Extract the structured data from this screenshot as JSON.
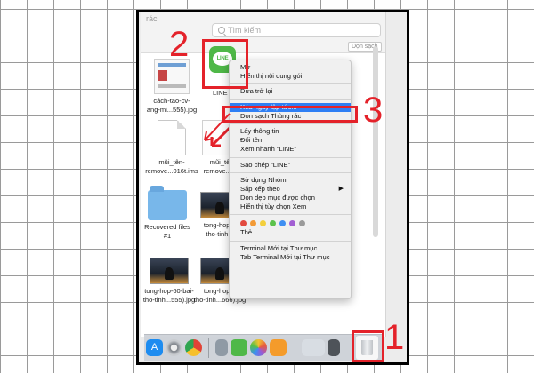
{
  "finder": {
    "title_fragment": "rác",
    "search_placeholder": "Tìm kiếm",
    "clear_button": "Dọn sạch"
  },
  "files": [
    {
      "label": "cách-tao-cv-\nang-mi...555).jpg"
    },
    {
      "label": "LINE"
    },
    {
      "label": "mũi_tên-\nremove...016t.ims"
    },
    {
      "label": "mũi_tê\nremove...w"
    },
    {
      "label": "Recovered files\n#1"
    },
    {
      "label": "tong-hop-6\ntho-tinh..."
    },
    {
      "label": "tong-hop-60-bai-\ntho-tinh...555).jpg"
    },
    {
      "label": "tong-hop-6\ntho-tinh...666).jpg"
    }
  ],
  "context_menu": {
    "group1": [
      "Mở",
      "Hiển thị nội dung gói"
    ],
    "group2": [
      "Đưa trở lại"
    ],
    "selected": "Xóa ngay lập tức...",
    "group3": [
      "Dọn sạch Thùng rác"
    ],
    "group4": [
      "Lấy thông tin",
      "Đổi tên",
      "Xem nhanh “LINE”"
    ],
    "group5": [
      "Sao chép “LINE”"
    ],
    "group6": [
      "Sử dụng Nhóm",
      "Sắp xếp theo",
      "Dọn dẹp mục được chọn",
      "Hiển thị tùy chọn Xem"
    ],
    "tag_colors": [
      "#e24a3f",
      "#f29a36",
      "#f3cf3c",
      "#5cc24c",
      "#3f8ff2",
      "#a25fd3",
      "#9a9a9a"
    ],
    "tags_label": "Thẻ...",
    "group8": [
      "Terminal Mới tại Thư mục",
      "Tab Terminal Mới tại Thư mục"
    ]
  },
  "dock": {
    "icons": [
      "app-store-icon",
      "system-preferences-icon",
      "chrome-icon",
      "finder-app-icon",
      "line-app-icon",
      "photos-icon",
      "home-icon",
      "keynote-icon",
      "screen-icon"
    ],
    "trash": "trash-icon"
  },
  "annotations": {
    "step1": "1",
    "step2": "2",
    "step3": "3",
    "accent": "#e4222a"
  }
}
